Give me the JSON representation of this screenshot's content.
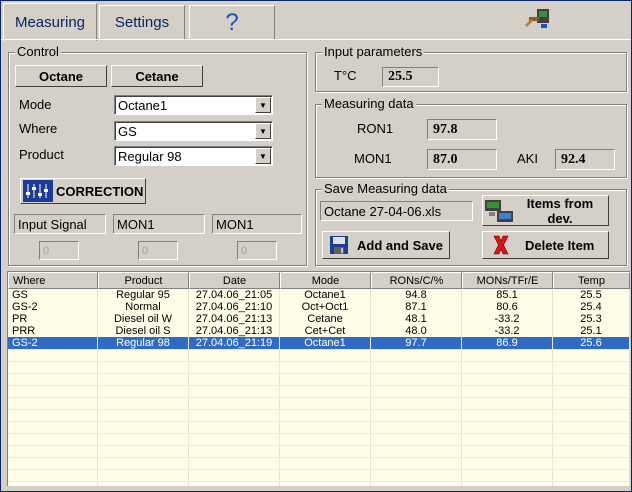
{
  "tabs": [
    {
      "label": "Measuring"
    },
    {
      "label": "Settings"
    },
    {
      "label": "?"
    }
  ],
  "control": {
    "title": "Control",
    "octane_label": "Octane",
    "cetane_label": "Cetane",
    "mode_label": "Mode",
    "mode_value": "Octane1",
    "where_label": "Where",
    "where_value": "GS",
    "product_label": "Product",
    "product_value": "Regular 98",
    "correction_label": "CORRECTION",
    "input_signal_label": "Input Signal",
    "signal_col1": "MON1",
    "signal_col2": "MON1",
    "inputs": [
      "0",
      "0",
      "0"
    ]
  },
  "input_params": {
    "title": "Input parameters",
    "t_label": "T°C",
    "t_value": "25.5"
  },
  "measuring": {
    "title": "Measuring data",
    "ron_label": "RON1",
    "ron_value": "97.8",
    "mon_label": "MON1",
    "mon_value": "87.0",
    "aki_label": "AKI",
    "aki_value": "92.4"
  },
  "save": {
    "title": "Save Measuring data",
    "filename": "Octane 27-04-06.xls",
    "items_from_dev_label": "Items from dev.",
    "add_save_label": "Add and Save",
    "delete_label": "Delete Item"
  },
  "table": {
    "headers": [
      "Where",
      "Product",
      "Date",
      "Mode",
      "RONs/C/%",
      "MONs/TFr/E",
      "Temp"
    ],
    "rows": [
      [
        "GS",
        "Regular 95",
        "27.04.06_21:05",
        "Octane1",
        "94.8",
        "85.1",
        "25.5"
      ],
      [
        "GS-2",
        "Normal",
        "27.04.06_21:10",
        "Oct+Oct1",
        "87.1",
        "80.6",
        "25.4"
      ],
      [
        "PR",
        "Diesel oil W",
        "27.04.06_21:13",
        "Cetane",
        "48.1",
        "-33.2",
        "25.3"
      ],
      [
        "PRR",
        "Diesel oil S",
        "27.04.06_21:13",
        "Cet+Cet",
        "48.0",
        "-33.2",
        "25.1"
      ],
      [
        "GS-2",
        "Regular 98",
        "27.04.06_21:19",
        "Octane1",
        "97.7",
        "86.9",
        "25.6"
      ]
    ],
    "selected_row": 4
  },
  "colors": {
    "selection": "#316ac5",
    "table_bg": "#fffce8",
    "window_bg": "#d4d0c8"
  }
}
